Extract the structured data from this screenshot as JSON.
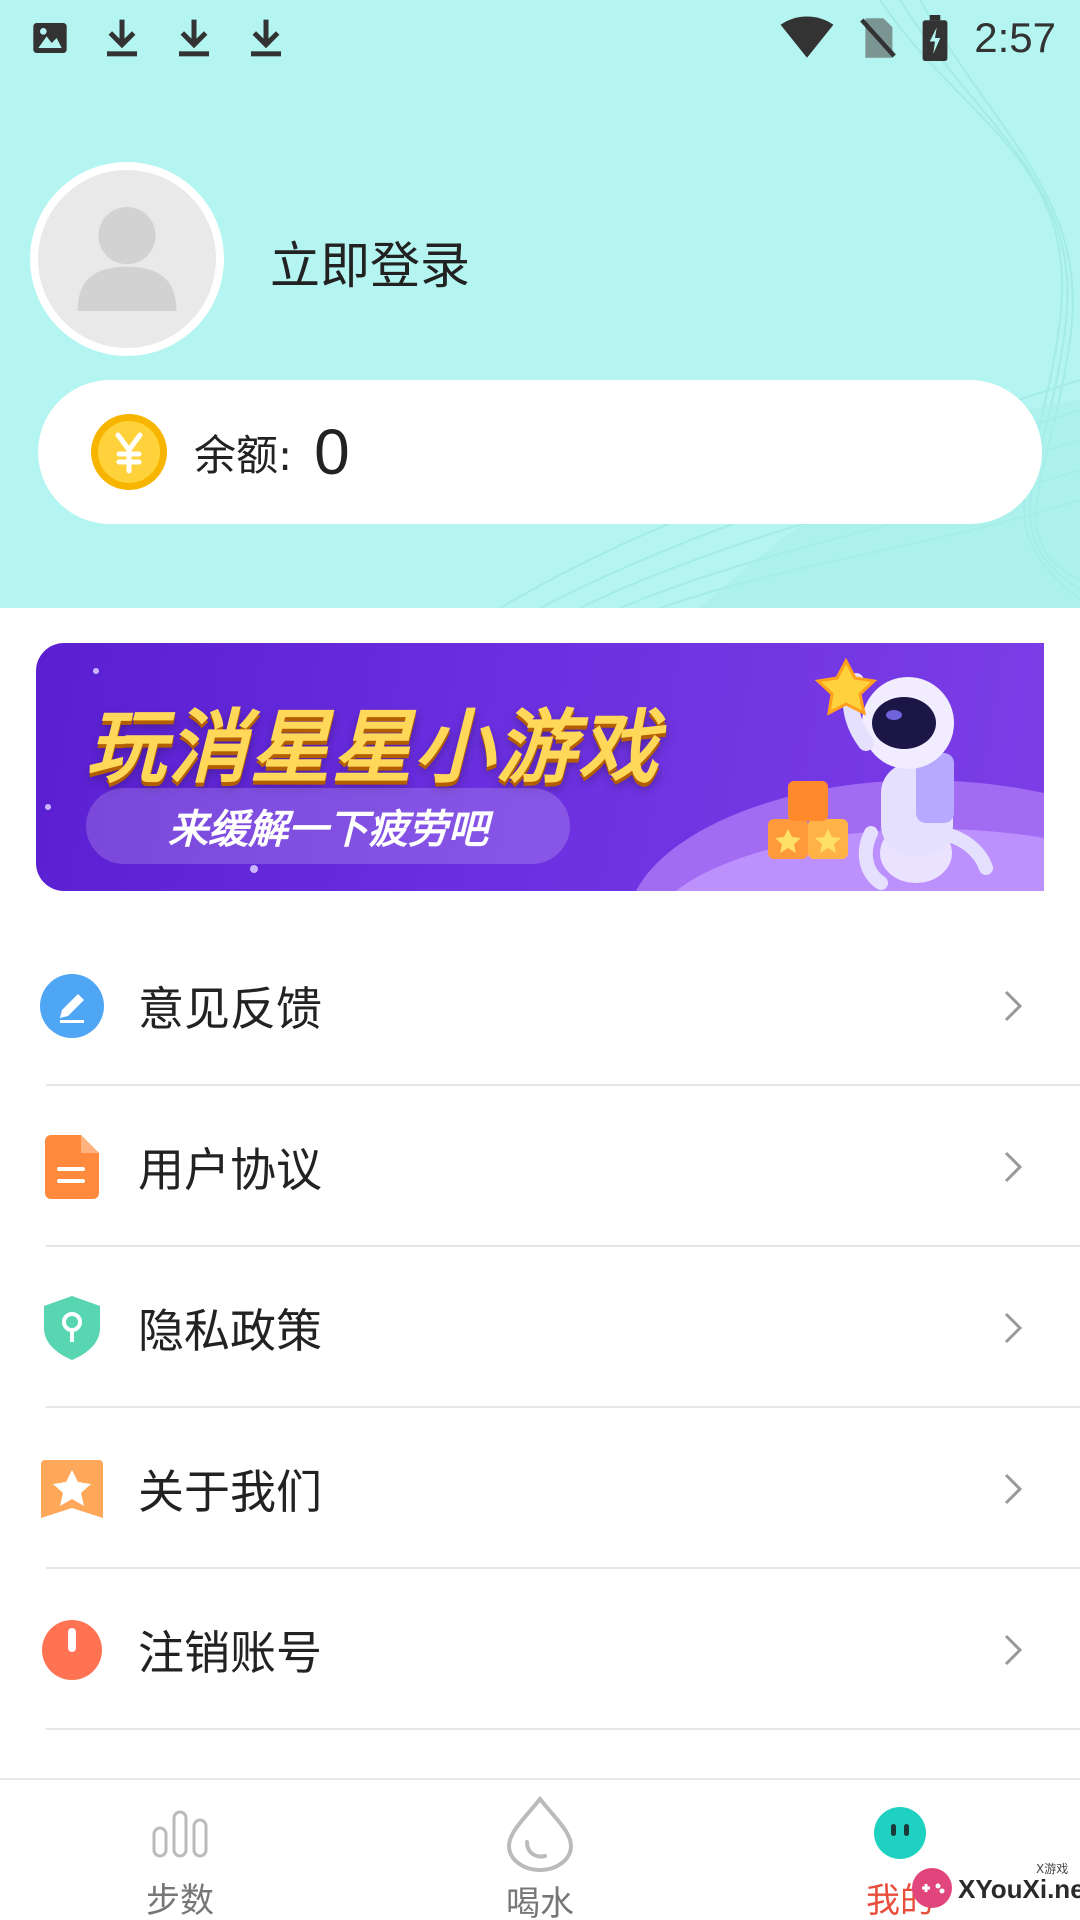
{
  "status_bar": {
    "time": "2:57",
    "left_icons": [
      "image-icon",
      "download-icon",
      "download-icon",
      "download-icon"
    ],
    "right_icons": [
      "wifi-icon",
      "no-sim-icon",
      "battery-charging-icon"
    ]
  },
  "profile": {
    "avatar_icon": "user-placeholder-icon",
    "login_label": "立即登录"
  },
  "balance": {
    "icon": "yuan-coin-icon",
    "label": "余额:",
    "value": "0"
  },
  "banner": {
    "title": "玩消星星小游戏",
    "subtitle": "来缓解一下疲劳吧",
    "colors": {
      "bg": "#6b2fe0",
      "title": "#ffd85a"
    }
  },
  "menu": {
    "items": [
      {
        "label": "意见反馈",
        "icon": "edit-pencil-icon",
        "color": "#4ea6f5"
      },
      {
        "label": "用户协议",
        "icon": "document-icon",
        "color": "#ff8a3d"
      },
      {
        "label": "隐私政策",
        "icon": "shield-icon",
        "color": "#57d6b1"
      },
      {
        "label": "关于我们",
        "icon": "star-ribbon-icon",
        "color": "#ffa85a"
      },
      {
        "label": "注销账号",
        "icon": "power-icon",
        "color": "#ff7352"
      }
    ]
  },
  "bottom_nav": {
    "tabs": [
      {
        "label": "步数",
        "icon": "bar-chart-icon",
        "active": false
      },
      {
        "label": "喝水",
        "icon": "water-drop-icon",
        "active": false
      },
      {
        "label": "我的",
        "icon": "face-icon",
        "active": true
      }
    ]
  },
  "watermark": {
    "text": "XYouXi.net",
    "small": "X游戏"
  },
  "theme": {
    "header_bg": "#b4f5f1",
    "active_tab": "#e94e3c",
    "teal": "#1fd1c0"
  }
}
